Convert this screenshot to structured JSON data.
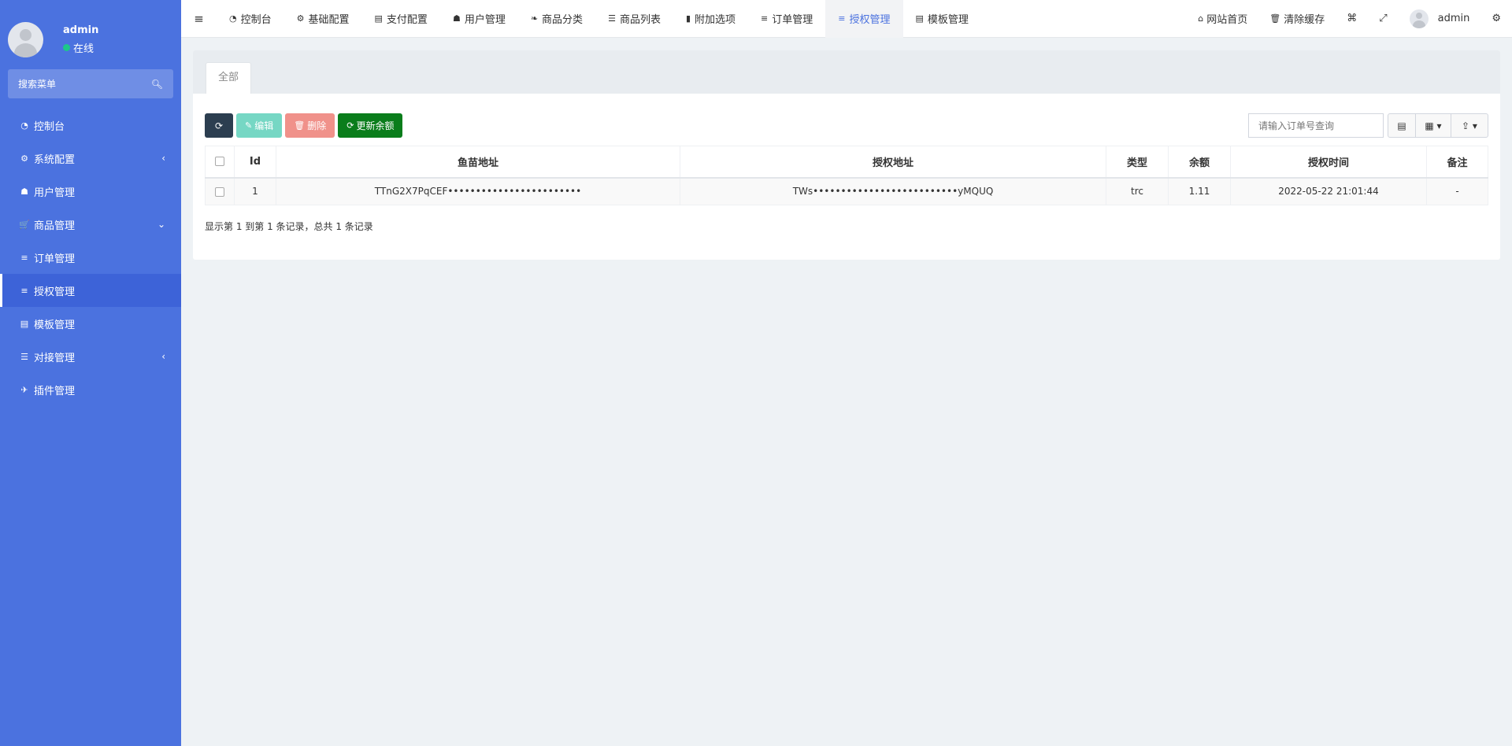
{
  "sidebar": {
    "user": {
      "name": "admin",
      "status": "在线"
    },
    "search_placeholder": "搜索菜单",
    "items": [
      {
        "label": "控制台",
        "icon": "dashboard-icon",
        "glyph": "◔"
      },
      {
        "label": "系统配置",
        "icon": "gear-icon",
        "glyph": "⚙",
        "arrow": "‹"
      },
      {
        "label": "用户管理",
        "icon": "user-icon",
        "glyph": "☗"
      },
      {
        "label": "商品管理",
        "icon": "cart-icon",
        "glyph": "🛒",
        "arrow": "⌄"
      },
      {
        "label": "订单管理",
        "icon": "list-icon",
        "glyph": "≡"
      },
      {
        "label": "授权管理",
        "icon": "list-icon",
        "glyph": "≡",
        "active": true
      },
      {
        "label": "模板管理",
        "icon": "template-icon",
        "glyph": "▤"
      },
      {
        "label": "对接管理",
        "icon": "sliders-icon",
        "glyph": "☰",
        "arrow": "‹"
      },
      {
        "label": "插件管理",
        "icon": "plug-icon",
        "glyph": "✈"
      }
    ]
  },
  "topbar": {
    "nav": [
      {
        "label": "控制台",
        "icon": "dashboard-icon",
        "glyph": "◔"
      },
      {
        "label": "基础配置",
        "icon": "gear-icon",
        "glyph": "⚙"
      },
      {
        "label": "支付配置",
        "icon": "payment-icon",
        "glyph": "▤"
      },
      {
        "label": "用户管理",
        "icon": "user-icon",
        "glyph": "☗"
      },
      {
        "label": "商品分类",
        "icon": "leaf-icon",
        "glyph": "❧"
      },
      {
        "label": "商品列表",
        "icon": "list-icon",
        "glyph": "☰"
      },
      {
        "label": "附加选项",
        "icon": "bookmark-icon",
        "glyph": "▮"
      },
      {
        "label": "订单管理",
        "icon": "list-icon",
        "glyph": "≡"
      },
      {
        "label": "授权管理",
        "icon": "list-icon",
        "glyph": "≡",
        "active": true
      },
      {
        "label": "模板管理",
        "icon": "template-icon",
        "glyph": "▤"
      }
    ],
    "home_label": "网站首页",
    "clear_cache_label": "清除缓存",
    "admin_label": "admin"
  },
  "panel": {
    "tab_all": "全部",
    "buttons": {
      "edit": "编辑",
      "delete": "删除",
      "update_balance": "更新余额"
    },
    "search_placeholder": "请输入订单号查询",
    "columns": [
      "Id",
      "鱼苗地址",
      "授权地址",
      "类型",
      "余额",
      "授权时间",
      "备注"
    ],
    "rows": [
      {
        "id": "1",
        "fish_address": "TTnG2X7PqCEF••••••••••••••••••••••••",
        "auth_address": "TWs••••••••••••••••••••••••••yMQUQ",
        "type": "trc",
        "balance": "1.11",
        "time": "2022-05-22 21:01:44",
        "note": "-"
      }
    ],
    "footer": "显示第 1 到第 1 条记录，总共 1 条记录"
  }
}
